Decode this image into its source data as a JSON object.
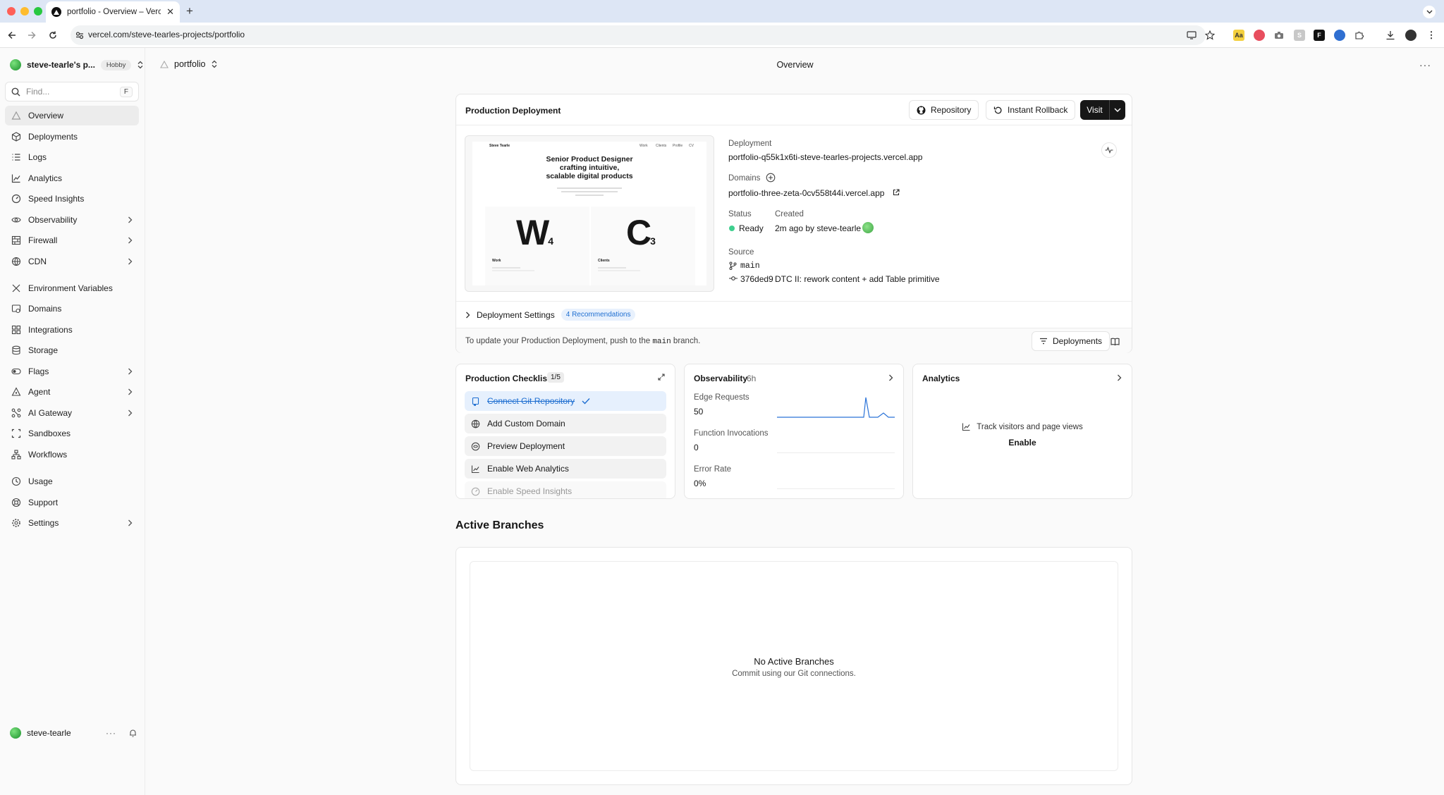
{
  "browser": {
    "tab_title": "portfolio - Overview – Vercel",
    "url": "vercel.com/steve-tearles-projects/portfolio"
  },
  "sidebar": {
    "team_name": "steve-tearle's p...",
    "plan_badge": "Hobby",
    "search_placeholder": "Find...",
    "search_shortcut": "F",
    "items": [
      {
        "label": "Overview",
        "icon": "triangle-icon"
      },
      {
        "label": "Deployments",
        "icon": "cube-icon"
      },
      {
        "label": "Logs",
        "icon": "list-icon"
      },
      {
        "label": "Analytics",
        "icon": "chart-icon"
      },
      {
        "label": "Speed Insights",
        "icon": "gauge-icon"
      },
      {
        "label": "Observability",
        "icon": "eye-icon"
      },
      {
        "label": "Firewall",
        "icon": "firewall-icon"
      },
      {
        "label": "CDN",
        "icon": "globe-icon"
      },
      {
        "label": "Environment Variables",
        "icon": "variable-icon"
      },
      {
        "label": "Domains",
        "icon": "domain-icon"
      },
      {
        "label": "Integrations",
        "icon": "integrations-icon"
      },
      {
        "label": "Storage",
        "icon": "database-icon"
      },
      {
        "label": "Flags",
        "icon": "toggle-icon"
      },
      {
        "label": "Agent",
        "icon": "agent-icon"
      },
      {
        "label": "AI Gateway",
        "icon": "gateway-icon"
      },
      {
        "label": "Sandboxes",
        "icon": "sandbox-icon"
      },
      {
        "label": "Workflows",
        "icon": "workflow-icon"
      },
      {
        "label": "Usage",
        "icon": "clock-icon"
      },
      {
        "label": "Support",
        "icon": "support-icon"
      },
      {
        "label": "Settings",
        "icon": "gear-icon"
      }
    ],
    "user_name": "steve-tearle"
  },
  "header": {
    "project": "portfolio",
    "page_title": "Overview"
  },
  "production": {
    "title": "Production Deployment",
    "repository_btn": "Repository",
    "rollback_btn": "Instant Rollback",
    "visit_btn": "Visit",
    "preview": {
      "brand": "Steve Tearle",
      "nav": [
        "Work",
        "Clients",
        "Profile",
        "CV"
      ],
      "headline_1": "Senior Product Designer",
      "headline_2": "crafting intuitive,",
      "headline_3": "scalable digital products",
      "tile_1_letter": "W",
      "tile_1_sub": "4",
      "tile_1_label": "Work",
      "tile_2_letter": "C",
      "tile_2_sub": "3",
      "tile_2_label": "Clients"
    },
    "deployment_label": "Deployment",
    "deployment_url": "portfolio-q55k1x6ti-steve-tearles-projects.vercel.app",
    "domains_label": "Domains",
    "domain_url": "portfolio-three-zeta-0cv558t44i.vercel.app",
    "status_label": "Status",
    "status_value": "Ready",
    "created_label": "Created",
    "created_value": "2m ago by steve-tearle",
    "source_label": "Source",
    "branch": "main",
    "commit_hash": "376ded9",
    "commit_message": "DTC II: rework content + add Table primitive",
    "settings_label": "Deployment Settings",
    "recommendations": "4 Recommendations",
    "note_before": "To update your Production Deployment, push to the",
    "note_branch": "main",
    "note_after": "branch.",
    "deployments_btn": "Deployments",
    "status_color": "#3ecf8e"
  },
  "checklist": {
    "title": "Production Checklist",
    "progress": "1/5",
    "items": [
      {
        "label": "Connect Git Repository",
        "done": true
      },
      {
        "label": "Add Custom Domain",
        "done": false
      },
      {
        "label": "Preview Deployment",
        "done": false
      },
      {
        "label": "Enable Web Analytics",
        "done": false
      },
      {
        "label": "Enable Speed Insights",
        "done": false
      }
    ]
  },
  "observability": {
    "title": "Observability",
    "range": "6h",
    "metrics": [
      {
        "label": "Edge Requests",
        "value": "50"
      },
      {
        "label": "Function Invocations",
        "value": "0"
      },
      {
        "label": "Error Rate",
        "value": "0%"
      }
    ],
    "accent": "#2b73d8"
  },
  "analytics": {
    "title": "Analytics",
    "empty_text": "Track visitors and page views",
    "enable": "Enable"
  },
  "branches": {
    "title": "Active Branches",
    "empty_title": "No Active Branches",
    "empty_sub": "Commit using our Git connections."
  }
}
